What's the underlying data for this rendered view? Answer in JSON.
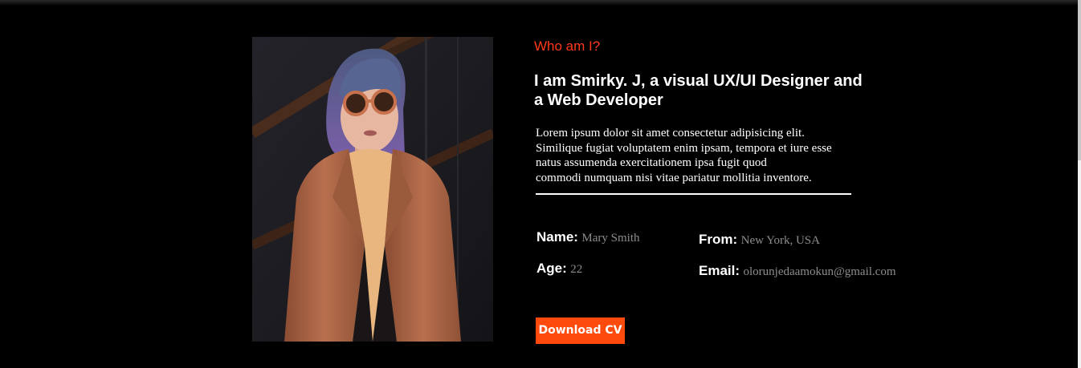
{
  "about": {
    "eyebrow": "Who am I?",
    "headline": "I am Smirky. J, a visual UX/UI Designer and a Web Developer",
    "bio_lines": [
      "Lorem ipsum dolor sit amet consectetur adipisicing elit.",
      "Similique fugiat voluptatem enim ipsam, tempora et iure esse",
      "natus assumenda exercitationem ipsa fugit quod",
      "commodi numquam nisi vitae pariatur mollitia inventore."
    ],
    "details": {
      "name_label": "Name:",
      "name_value": "Mary Smith",
      "age_label": "Age:",
      "age_value": "22",
      "from_label": "From:",
      "from_value": "New York, USA",
      "email_label": "Email:",
      "email_value": "olorunjedaamokun@gmail.com"
    },
    "download_button": "Download CV"
  },
  "colors": {
    "background": "#000000",
    "accent": "#ff4a0d",
    "eyebrow": "#ff3a1a",
    "muted_value": "#8c8c8c",
    "text": "#ffffff"
  }
}
